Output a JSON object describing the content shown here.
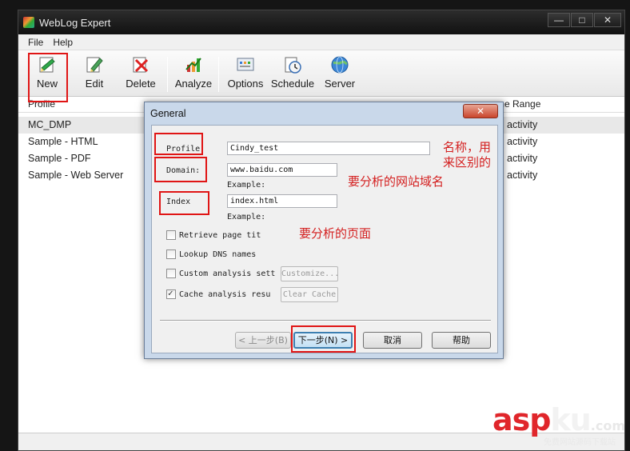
{
  "window": {
    "title": "WebLog Expert",
    "minimize": "—",
    "maximize": "□",
    "close": "✕"
  },
  "menu": [
    "File",
    "Help"
  ],
  "toolbar": {
    "new": "New",
    "edit": "Edit",
    "delete": "Delete",
    "analyze": "Analyze",
    "options": "Options",
    "schedule": "Schedule",
    "server": "Server"
  },
  "list": {
    "col_profile": "Profile",
    "col_time_range": "me Range",
    "rows": [
      {
        "name": "MC_DMP",
        "range": "activity"
      },
      {
        "name": "Sample - HTML",
        "range": "activity"
      },
      {
        "name": "Sample - PDF",
        "range": "activity"
      },
      {
        "name": "Sample - Web Server",
        "range": "activity"
      }
    ]
  },
  "dialog": {
    "title": "General",
    "close": "✕",
    "profile_label": "Profile",
    "profile_value": "Cindy_test",
    "domain_label": "Domain:",
    "domain_value": "www.baidu.com",
    "domain_example": "Example:",
    "index_label": "Index",
    "index_value": "index.html",
    "index_example": "Example:",
    "cb_retrieve": "Retrieve page tit",
    "cb_lookup": "Lookup DNS names",
    "cb_custom": "Custom analysis sett",
    "cb_cache": "Cache analysis resu",
    "btn_customize": "Customize...",
    "btn_clear_cache": "Clear Cache",
    "btn_back": "< 上一步(B)",
    "btn_next": "下一步(N) >",
    "btn_cancel": "取消",
    "btn_help": "帮助"
  },
  "annotations": {
    "note_name": [
      "名称，用",
      "来区别的"
    ],
    "note_domain": "要分析的网站域名",
    "note_page": "要分析的页面"
  },
  "watermark": {
    "a": "asp",
    "b": "ku",
    "c": ".com",
    "sub": "免费网站源码下载站"
  },
  "colors": {
    "annotation": "#e01515",
    "dialog_frame": "#c9d8ea",
    "titlebar": "#1c1c1c"
  }
}
